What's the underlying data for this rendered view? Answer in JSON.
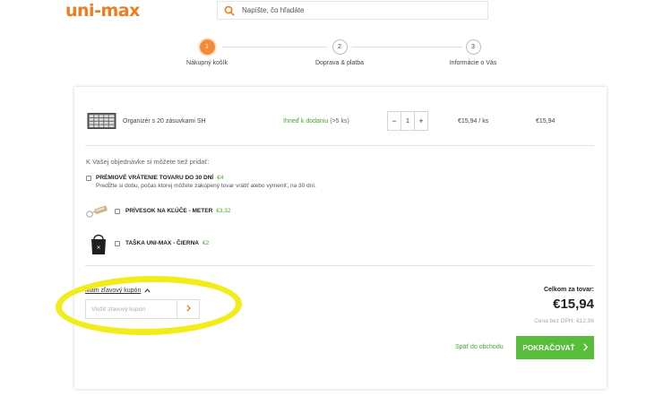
{
  "header": {
    "logo": "uni-max",
    "search_placeholder": "Napíšte, čo hľadáte"
  },
  "steps": [
    {
      "number": "1",
      "label": "Nákupný košík",
      "active": true
    },
    {
      "number": "2",
      "label": "Doprava & platba",
      "active": false
    },
    {
      "number": "3",
      "label": "Informácie o Vás",
      "active": false
    }
  ],
  "cart": {
    "item": {
      "name": "Organizér s 20 zásuvkami SH",
      "availability": "Ihneď k dodaniu",
      "availability_note": "(>5 ks)",
      "quantity": "1",
      "qty_minus": "−",
      "qty_plus": "+",
      "unit_price": "€15,94 / ks",
      "total": "€15,94"
    },
    "addons_heading": "K Vašej objednávke si môžete tiež pridať:",
    "addons": [
      {
        "title": "PRÉMIOVÉ VRÁTENIE TOVARU DO 30 DNÍ",
        "price": "€4",
        "desc": "Predĺžte si dobu, počas ktorej môžete zakúpený tovar vrátiť alebo vymeniť, na 30 dní."
      },
      {
        "title": "PRÍVESOK NA KĽÚČE - METER",
        "price": "€3,32"
      },
      {
        "title": "TAŠKA UNI-MAX - ČIERNA",
        "price": "€2"
      }
    ],
    "coupon": {
      "link": "Mám zľavový kupón",
      "placeholder": "Vložiť zľavový kupón"
    },
    "summary": {
      "label": "Celkom za tovar:",
      "value": "€15,94",
      "vat": "Cena bez DPH: €12,96"
    },
    "back_label": "Späť do obchodu",
    "continue_label": "POKRAČOVAŤ"
  },
  "colors": {
    "brand": "#f07b20",
    "green": "#57bd3a",
    "highlight": "#f2ec1a"
  }
}
